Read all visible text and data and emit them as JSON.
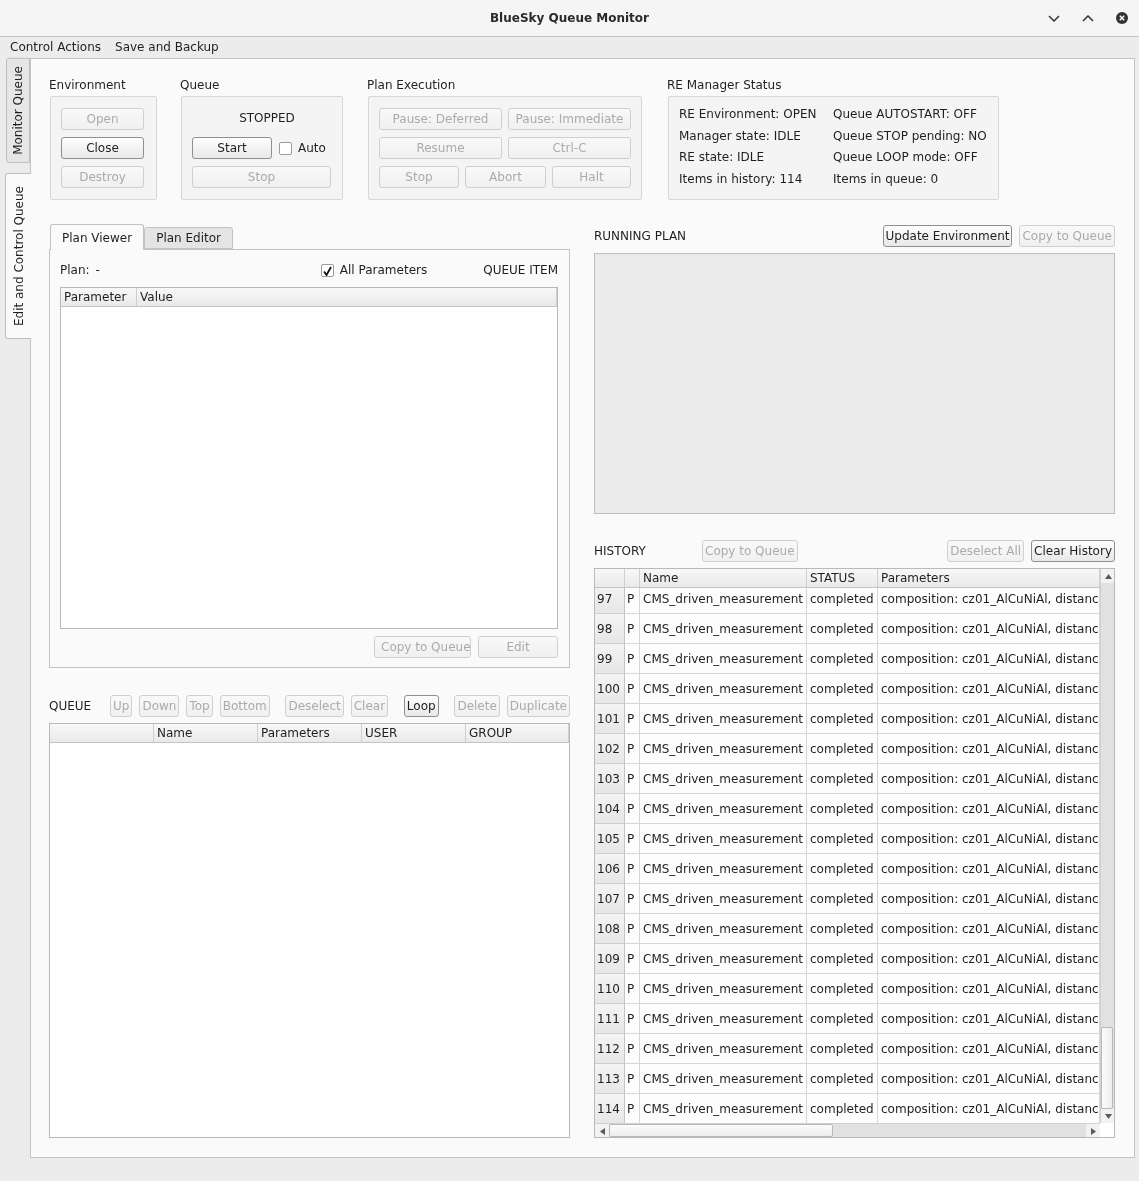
{
  "window": {
    "title": "BlueSky Queue Monitor"
  },
  "menu": [
    {
      "label": "Control Actions"
    },
    {
      "label": "Save and Backup"
    }
  ],
  "side_tabs": [
    {
      "label": "Monitor Queue",
      "selected": false
    },
    {
      "label": "Edit and Control Queue",
      "selected": true
    }
  ],
  "environment": {
    "title": "Environment",
    "buttons": [
      {
        "label": "Open",
        "disabled": true
      },
      {
        "label": "Close",
        "disabled": false
      },
      {
        "label": "Destroy",
        "disabled": true
      }
    ]
  },
  "queue_control": {
    "title": "Queue",
    "status": "STOPPED",
    "start_button": {
      "label": "Start",
      "disabled": false
    },
    "auto": {
      "label": "Auto",
      "checked": false
    },
    "stop_button": {
      "label": "Stop",
      "disabled": true
    }
  },
  "plan_execution": {
    "title": "Plan Execution",
    "button_rows": [
      [
        {
          "label": "Pause: Deferred",
          "disabled": true
        },
        {
          "label": "Pause: Immediate",
          "disabled": true
        }
      ],
      [
        {
          "label": "Resume",
          "disabled": true
        },
        {
          "label": "Ctrl-C",
          "disabled": true
        }
      ],
      [
        {
          "label": "Stop",
          "disabled": true
        },
        {
          "label": "Abort",
          "disabled": true
        },
        {
          "label": "Halt",
          "disabled": true
        }
      ]
    ]
  },
  "re_manager_status": {
    "title": "RE Manager Status",
    "items": [
      "RE Environment: OPEN",
      "Queue AUTOSTART: OFF",
      "Manager state: IDLE",
      "Queue STOP pending: NO",
      "RE state: IDLE",
      "Queue LOOP mode: OFF",
      "Items in history: 114",
      "Items in queue: 0"
    ]
  },
  "plan_tabs": [
    {
      "label": "Plan Viewer",
      "selected": true
    },
    {
      "label": "Plan Editor",
      "selected": false
    }
  ],
  "plan_viewer": {
    "plan_label": "Plan:",
    "plan_name": "-",
    "all_parameters": {
      "label": "All Parameters",
      "checked": true
    },
    "item_type": "QUEUE ITEM",
    "table": {
      "columns": [
        "Parameter",
        "Value"
      ]
    },
    "buttons": [
      {
        "label": "Copy to Queue",
        "disabled": true
      },
      {
        "label": "Edit",
        "disabled": true
      }
    ]
  },
  "queue": {
    "title": "QUEUE",
    "button_groups": [
      [
        {
          "label": "Up",
          "disabled": true
        },
        {
          "label": "Down",
          "disabled": true
        },
        {
          "label": "Top",
          "disabled": true
        },
        {
          "label": "Bottom",
          "disabled": true
        }
      ],
      [
        {
          "label": "Deselect",
          "disabled": true
        },
        {
          "label": "Clear",
          "disabled": true
        }
      ],
      [
        {
          "label": "Loop",
          "disabled": false
        }
      ],
      [
        {
          "label": "Delete",
          "disabled": true
        },
        {
          "label": "Duplicate",
          "disabled": true
        }
      ]
    ],
    "table": {
      "columns": [
        "Name",
        "Parameters",
        "USER",
        "GROUP"
      ]
    }
  },
  "running_plan": {
    "title": "RUNNING PLAN",
    "buttons": [
      {
        "label": "Update Environment",
        "disabled": false
      },
      {
        "label": "Copy to Queue",
        "disabled": true
      }
    ]
  },
  "history": {
    "title": "HISTORY",
    "copy_button": {
      "label": "Copy to Queue",
      "disabled": true
    },
    "buttons": [
      {
        "label": "Deselect All",
        "disabled": true
      },
      {
        "label": "Clear History",
        "disabled": false
      }
    ],
    "table": {
      "columns": [
        "Name",
        "STATUS",
        "Parameters"
      ],
      "rows": [
        {
          "number": "97",
          "type": "P",
          "name": "CMS_driven_measurement",
          "status": "completed",
          "parameters": "composition: cz01_AlCuNiAl, distanc"
        },
        {
          "number": "98",
          "type": "P",
          "name": "CMS_driven_measurement",
          "status": "completed",
          "parameters": "composition: cz01_AlCuNiAl, distanc"
        },
        {
          "number": "99",
          "type": "P",
          "name": "CMS_driven_measurement",
          "status": "completed",
          "parameters": "composition: cz01_AlCuNiAl, distanc"
        },
        {
          "number": "100",
          "type": "P",
          "name": "CMS_driven_measurement",
          "status": "completed",
          "parameters": "composition: cz01_AlCuNiAl, distanc"
        },
        {
          "number": "101",
          "type": "P",
          "name": "CMS_driven_measurement",
          "status": "completed",
          "parameters": "composition: cz01_AlCuNiAl, distanc"
        },
        {
          "number": "102",
          "type": "P",
          "name": "CMS_driven_measurement",
          "status": "completed",
          "parameters": "composition: cz01_AlCuNiAl, distanc"
        },
        {
          "number": "103",
          "type": "P",
          "name": "CMS_driven_measurement",
          "status": "completed",
          "parameters": "composition: cz01_AlCuNiAl, distanc"
        },
        {
          "number": "104",
          "type": "P",
          "name": "CMS_driven_measurement",
          "status": "completed",
          "parameters": "composition: cz01_AlCuNiAl, distanc"
        },
        {
          "number": "105",
          "type": "P",
          "name": "CMS_driven_measurement",
          "status": "completed",
          "parameters": "composition: cz01_AlCuNiAl, distanc"
        },
        {
          "number": "106",
          "type": "P",
          "name": "CMS_driven_measurement",
          "status": "completed",
          "parameters": "composition: cz01_AlCuNiAl, distanc"
        },
        {
          "number": "107",
          "type": "P",
          "name": "CMS_driven_measurement",
          "status": "completed",
          "parameters": "composition: cz01_AlCuNiAl, distanc"
        },
        {
          "number": "108",
          "type": "P",
          "name": "CMS_driven_measurement",
          "status": "completed",
          "parameters": "composition: cz01_AlCuNiAl, distanc"
        },
        {
          "number": "109",
          "type": "P",
          "name": "CMS_driven_measurement",
          "status": "completed",
          "parameters": "composition: cz01_AlCuNiAl, distanc"
        },
        {
          "number": "110",
          "type": "P",
          "name": "CMS_driven_measurement",
          "status": "completed",
          "parameters": "composition: cz01_AlCuNiAl, distanc"
        },
        {
          "number": "111",
          "type": "P",
          "name": "CMS_driven_measurement",
          "status": "completed",
          "parameters": "composition: cz01_AlCuNiAl, distanc"
        },
        {
          "number": "112",
          "type": "P",
          "name": "CMS_driven_measurement",
          "status": "completed",
          "parameters": "composition: cz01_AlCuNiAl, distanc"
        },
        {
          "number": "113",
          "type": "P",
          "name": "CMS_driven_measurement",
          "status": "completed",
          "parameters": "composition: cz01_AlCuNiAl, distanc"
        },
        {
          "number": "114",
          "type": "P",
          "name": "CMS_driven_measurement",
          "status": "completed",
          "parameters": "composition: cz01_AlCuNiAl, distanc"
        }
      ]
    }
  }
}
